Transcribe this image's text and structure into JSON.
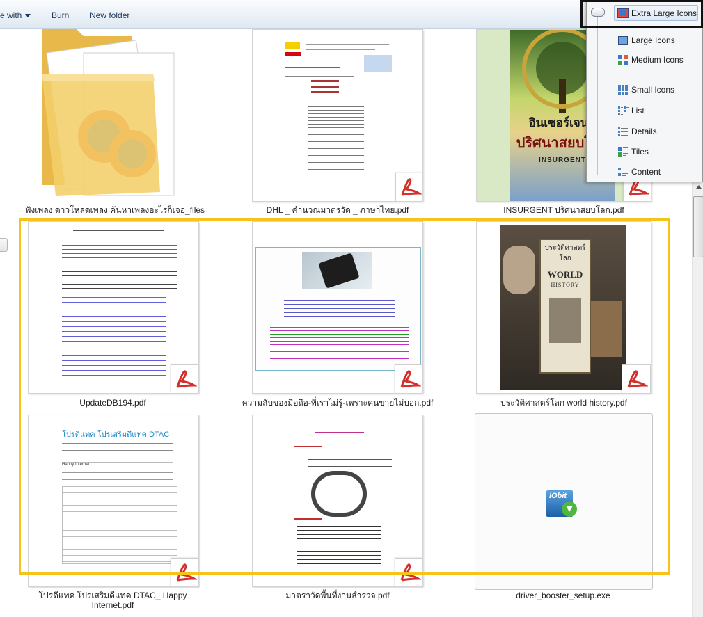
{
  "toolbar": {
    "open_with": "e with",
    "burn": "Burn",
    "new_folder": "New folder"
  },
  "view_menu": {
    "items": [
      {
        "label": "Extra Large Icons",
        "icon": "extra-large-icons-icon",
        "selected": true
      },
      {
        "label": "Large Icons",
        "icon": "large-icons-icon"
      },
      {
        "label": "Medium Icons",
        "icon": "medium-icons-icon"
      },
      {
        "label": "Small Icons",
        "icon": "small-icons-icon"
      },
      {
        "label": "List",
        "icon": "list-view-icon"
      },
      {
        "label": "Details",
        "icon": "details-view-icon"
      },
      {
        "label": "Tiles",
        "icon": "tiles-view-icon"
      },
      {
        "label": "Content",
        "icon": "content-view-icon"
      }
    ]
  },
  "files": [
    {
      "name": "ฟังเพลง ดาวโหลดเพลง ค้นหาเพลงอะไรก็เจอ_files",
      "type": "folder"
    },
    {
      "name": "DHL _ คำนวณมาตรวัด _ ภาษาไทย.pdf",
      "type": "pdf"
    },
    {
      "name": "INSURGENT ปริศนาสยบโลก.pdf",
      "type": "pdf"
    },
    {
      "name": "UpdateDB194.pdf",
      "type": "pdf"
    },
    {
      "name": "ความลับของมือถือ-ที่เราไม่รู้-เพราะคนขายไม่บอก.pdf",
      "type": "pdf"
    },
    {
      "name": "ประวัติศาสตร์โลก world history.pdf",
      "type": "pdf"
    },
    {
      "name": "โปรดีแทค โปรเสริมดีแทค DTAC_ Happy Internet.pdf",
      "type": "pdf"
    },
    {
      "name": "มาตราวัดพื้นที่งานสำรวจ.pdf",
      "type": "pdf"
    },
    {
      "name": "driver_booster_setup.exe",
      "type": "exe"
    }
  ],
  "thumb_text": {
    "insurgent_title": "อินเซอร์เจนท์",
    "insurgent_subtitle": "ปริศนาสยบโลก",
    "insurgent_en": "INSURGENT",
    "world_th": "ประวัติศาสตร์โลก",
    "world_en1": "WORLD",
    "world_en2": "HISTORY",
    "dtac_title": "โปรดีแทค โปรเสริมดีแทค DTAC",
    "dtac_section": "Happy Internet",
    "iobit": "IObit",
    "dhl": "DHL"
  },
  "colors": {
    "selection": "#f7c31a",
    "folder": "#f3cf69",
    "pdf_red": "#d2302a",
    "dtac_blue": "#1a88c9"
  }
}
